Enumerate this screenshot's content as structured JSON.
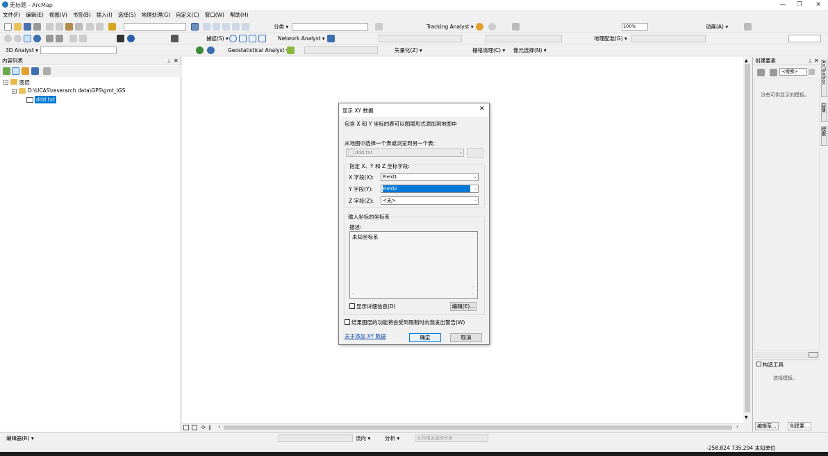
{
  "window": {
    "title": "无标题 - ArcMap",
    "min": "—",
    "max": "❐",
    "close": "✕"
  },
  "menus": [
    "文件(F)",
    "编辑(E)",
    "视图(V)",
    "书签(B)",
    "插入(I)",
    "选择(S)",
    "地理处理(G)",
    "自定义(C)",
    "窗口(W)",
    "帮助(H)"
  ],
  "toolbar1": {
    "classify": "分类 ▾",
    "tracking": "Tracking Analyst ▾",
    "zoom": "100%",
    "animation": "动画(A) ▾"
  },
  "toolbar2": {
    "capture": "捕捉(S) ▾",
    "network": "Network Analyst ▾",
    "georef": "地理配准(G) ▾"
  },
  "toolbar3": {
    "analyst3d": "3D Analyst ▾",
    "geostat": "Geostatistical Analyst ▾",
    "vectorize": "矢量化(Z) ▾",
    "raster_clean": "栅格清理(C) ▾",
    "cell_select": "像元选择(N) ▾"
  },
  "toc": {
    "title": "内容列表",
    "layers": "图层",
    "folder": "D:\\UCAS\\reserarch data\\GPS\\gmt_IGS",
    "table": "ddd.txt"
  },
  "create_features": {
    "title": "创建要素",
    "search": "<搜索>",
    "empty": "没有可供显示的模板。",
    "construct_title": "构造工具",
    "construct_empty": "选择模板。",
    "tab_template": "编辑草...",
    "tab_create": "创建要..."
  },
  "side_tabs": [
    "ArcToolbox",
    "目录",
    "搜索"
  ],
  "bottom_toolbar": {
    "editor": "编辑器(R) ▾",
    "flow": "流向 ▾",
    "analysis": "分析 ▾",
    "common": "公共相关选择分析"
  },
  "status": {
    "coords": "-258.824  735.294 未知单位"
  },
  "dialog": {
    "title": "显示 XY 数据",
    "description": "包含 X 和 Y 坐标的表可以图层形式添加到地图中",
    "choose_label": "从地图中选择一个表或浏览到另一个表:",
    "table_value": "ddd.txt",
    "fields_group": "指定 X、Y 和 Z 坐标字段:",
    "x_label": "X 字段(X):",
    "x_value": "Field1",
    "y_label": "Y 字段(Y):",
    "y_value": "Field2",
    "z_label": "Z 字段(Z):",
    "z_value": "<无>",
    "coord_group": "输入坐标的坐标系",
    "desc_label": "描述:",
    "coord_value": "未知坐标系",
    "show_details": "显示详细信息(D)",
    "edit_button": "编辑(E)...",
    "warning": "结果图层的功能将会受到限制时向我发出警告(W)",
    "help_link": "关于添加 XY 数据",
    "ok": "确定",
    "cancel": "取消"
  }
}
